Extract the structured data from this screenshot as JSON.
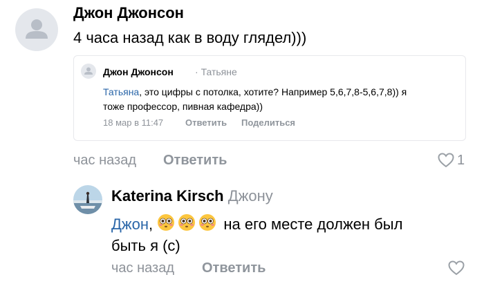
{
  "comment1": {
    "author": "Джон Джонсон",
    "text": "4 часа назад как в воду глядел)))",
    "quote": {
      "author": "Джон Джонсон",
      "reply_to": "Татьяне",
      "mention": "Татьяна",
      "text": ", это цифры с потолка, хотите? Например 5,6,7,8-5,6,7,8)) я",
      "text2": "тоже профессор, пивная кафедра))",
      "date": "18 мар в 11:47",
      "reply_label": "Ответить",
      "share_label": "Поделиться"
    },
    "time": "час назад",
    "reply_label": "Ответить",
    "like_count": "1"
  },
  "comment2": {
    "author": "Katerina Kirsch",
    "reply_to": "Джону",
    "mention": "Джон",
    "text_after_emojis": "на его месте должен был",
    "text_line2": "быть я (с)",
    "time": "час назад",
    "reply_label": "Ответить"
  },
  "colors": {
    "link_blue": "#2a66a8",
    "muted_gray": "#8d9299",
    "heart_gray": "#9aa0a6"
  }
}
